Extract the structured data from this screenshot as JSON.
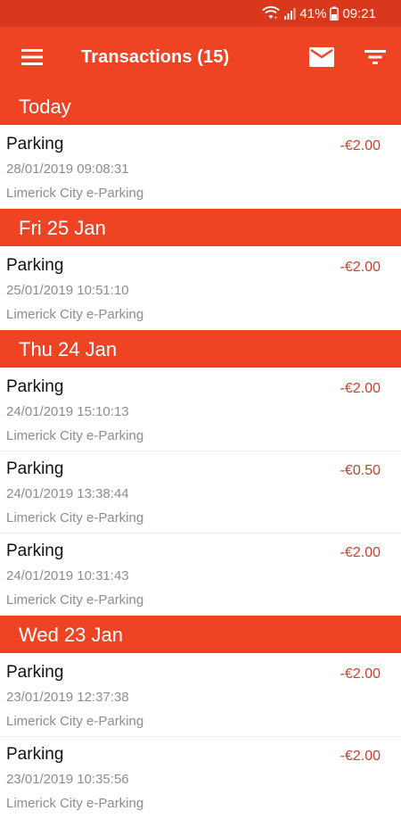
{
  "status_bar": {
    "battery": "41%",
    "time": "09:21",
    "icons": [
      "wifi-icon",
      "signal-icon",
      "battery-icon"
    ]
  },
  "app_bar": {
    "title": "Transactions (15)",
    "icons": [
      "menu-icon",
      "mail-icon",
      "filter-icon"
    ]
  },
  "colors": {
    "primary": "#ee4424",
    "status_bar": "#d9381d",
    "amount": "#d63a2a",
    "secondary_text": "#8d8d8d"
  },
  "sections": [
    {
      "header": "Today",
      "transactions": [
        {
          "title": "Parking",
          "datetime": "28/01/2019 09:08:31",
          "provider": "Limerick City e-Parking",
          "amount": "-€2.00"
        }
      ]
    },
    {
      "header": "Fri 25 Jan",
      "transactions": [
        {
          "title": "Parking",
          "datetime": "25/01/2019 10:51:10",
          "provider": "Limerick City e-Parking",
          "amount": "-€2.00"
        }
      ]
    },
    {
      "header": "Thu 24 Jan",
      "transactions": [
        {
          "title": "Parking",
          "datetime": "24/01/2019 15:10:13",
          "provider": "Limerick City e-Parking",
          "amount": "-€2.00"
        },
        {
          "title": "Parking",
          "datetime": "24/01/2019 13:38:44",
          "provider": "Limerick City e-Parking",
          "amount": "-€0.50"
        },
        {
          "title": "Parking",
          "datetime": "24/01/2019 10:31:43",
          "provider": "Limerick City e-Parking",
          "amount": "-€2.00"
        }
      ]
    },
    {
      "header": "Wed 23 Jan",
      "transactions": [
        {
          "title": "Parking",
          "datetime": "23/01/2019 12:37:38",
          "provider": "Limerick City e-Parking",
          "amount": "-€2.00"
        },
        {
          "title": "Parking",
          "datetime": "23/01/2019 10:35:56",
          "provider": "Limerick City e-Parking",
          "amount": "-€2.00"
        }
      ]
    }
  ]
}
